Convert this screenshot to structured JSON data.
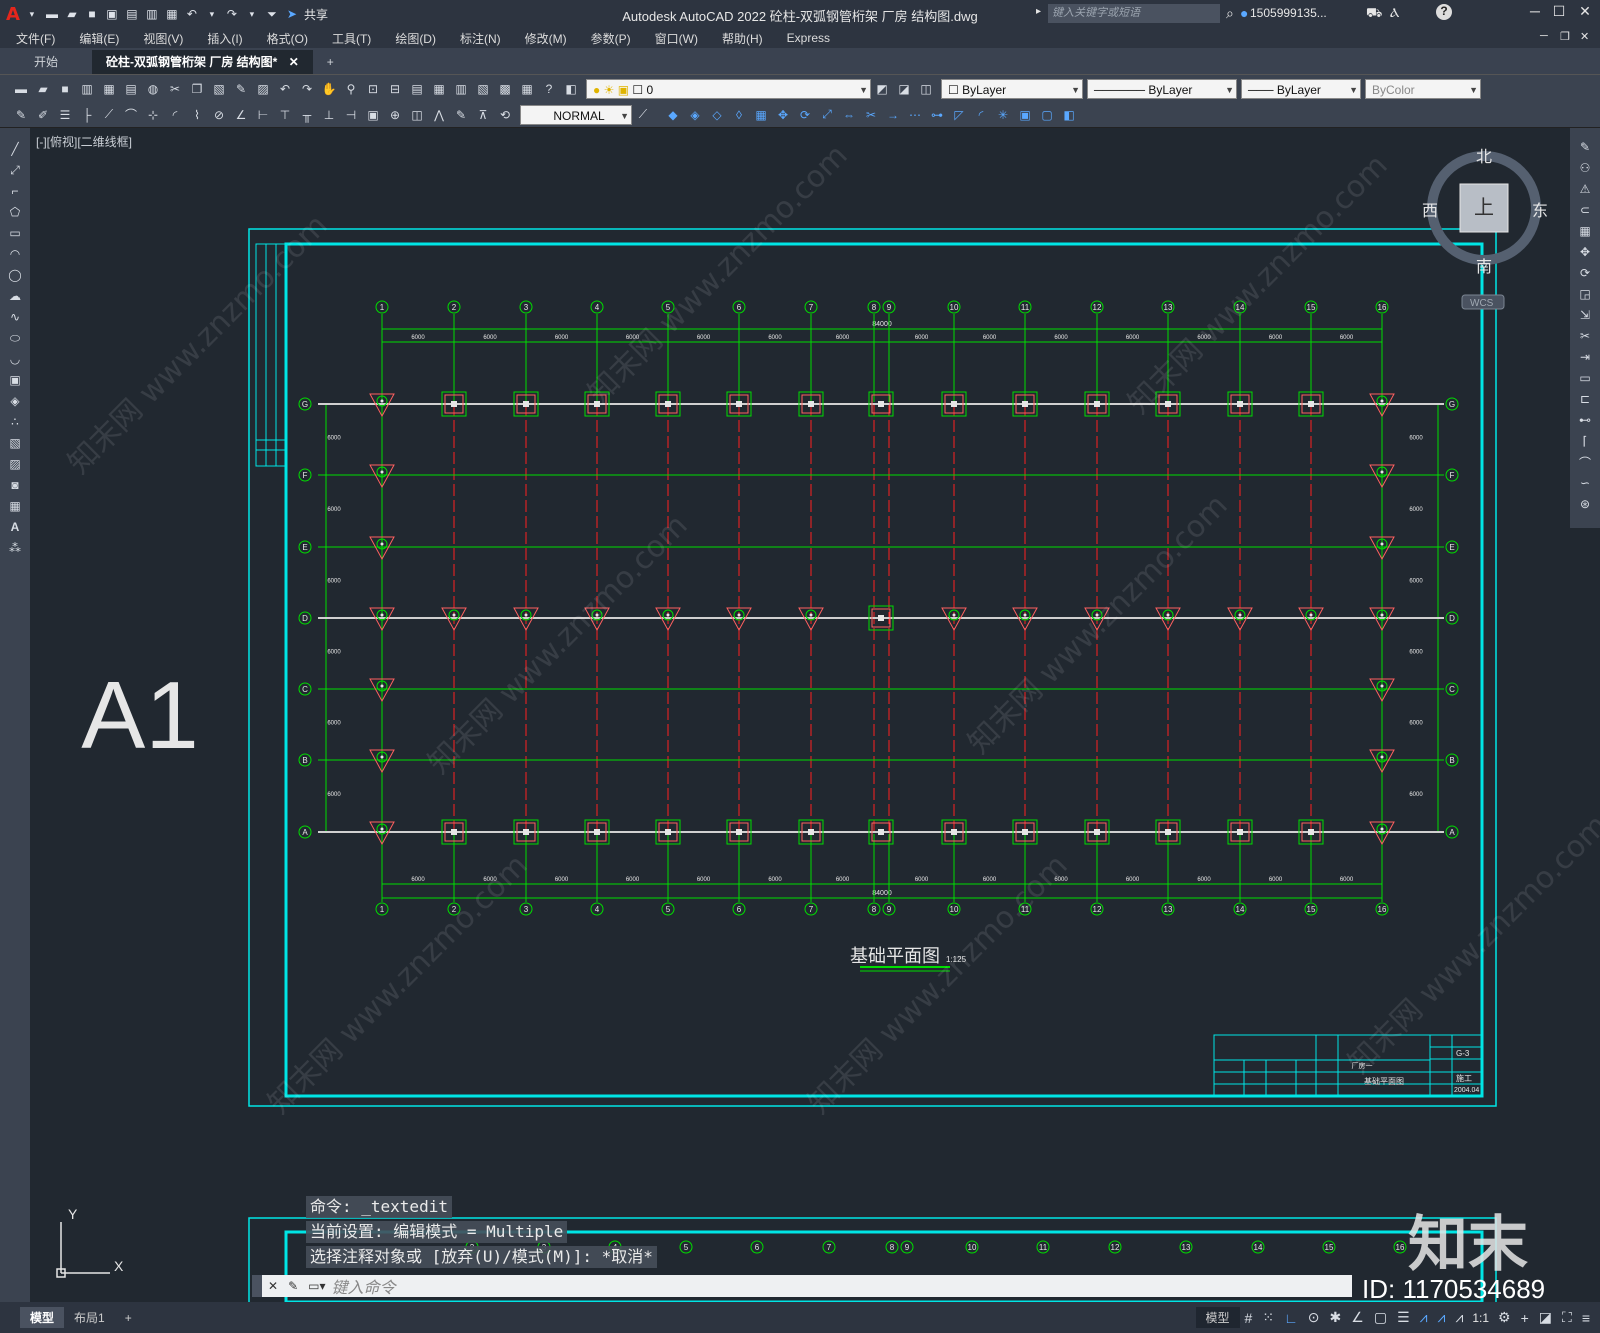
{
  "app": {
    "title": "Autodesk AutoCAD 2022    砼柱-双弧钢管桁架 厂房    结构图.dwg",
    "share": "共享",
    "search_placeholder": "键入关键字或短语",
    "user": "1505999135...",
    "help": "?"
  },
  "menu": [
    "文件(F)",
    "编辑(E)",
    "视图(V)",
    "插入(I)",
    "格式(O)",
    "工具(T)",
    "绘图(D)",
    "标注(N)",
    "修改(M)",
    "参数(P)",
    "窗口(W)",
    "帮助(H)",
    "Express"
  ],
  "tabs": {
    "start": "开始",
    "doc": "砼柱-双弧钢管桁架 厂房    结构图*",
    "close": "✕",
    "add": "+"
  },
  "toolbar": {
    "layer": "0",
    "color": "ByLayer",
    "linetype": "ByLayer",
    "lineweight": "ByLayer",
    "plotstyle": "ByColor",
    "dimstyle": "NORMAL"
  },
  "viewport": {
    "label": "[-][俯视][二维线框]"
  },
  "viewcube": {
    "n": "北",
    "s": "南",
    "e": "东",
    "w": "西",
    "top": "上",
    "wcs": "WCS"
  },
  "drawing": {
    "sheet_label": "A1",
    "plan_title": "基础平面图",
    "plan_scale": "1:125",
    "total_dim": "84000",
    "bay_dim": "6000",
    "grid_x": [
      "1",
      "2",
      "3",
      "4",
      "5",
      "6",
      "7",
      "8",
      "9",
      "10",
      "11",
      "12",
      "13",
      "14",
      "15",
      "16"
    ],
    "grid_y": [
      "G",
      "F",
      "E",
      "D",
      "C",
      "B",
      "A"
    ],
    "titleblock": {
      "drawing_no": "G-3",
      "stage": "施工",
      "date": "2004.04",
      "name": "基础平面图",
      "project": "厂房一"
    }
  },
  "command": {
    "line1": "命令: _textedit",
    "line2": "当前设置: 编辑模式 = Multiple",
    "line3": "选择注释对象或 [放弃(U)/模式(M)]: *取消*",
    "placeholder": "键入命令"
  },
  "status": {
    "model_tab": "模型",
    "layout_tab": "布局1",
    "add": "+",
    "model_btn": "模型",
    "scale": "1:1"
  },
  "ucs": {
    "x": "X",
    "y": "Y"
  },
  "watermark": {
    "brand": "知末",
    "id": "ID: 1170534689",
    "site": "知末网 www.znzmo.com"
  },
  "colors": {
    "bg": "#212830",
    "frame": "#00e5e5",
    "grid": "#00dd00",
    "axis": "#ff2020",
    "accent": "#e4261c"
  }
}
